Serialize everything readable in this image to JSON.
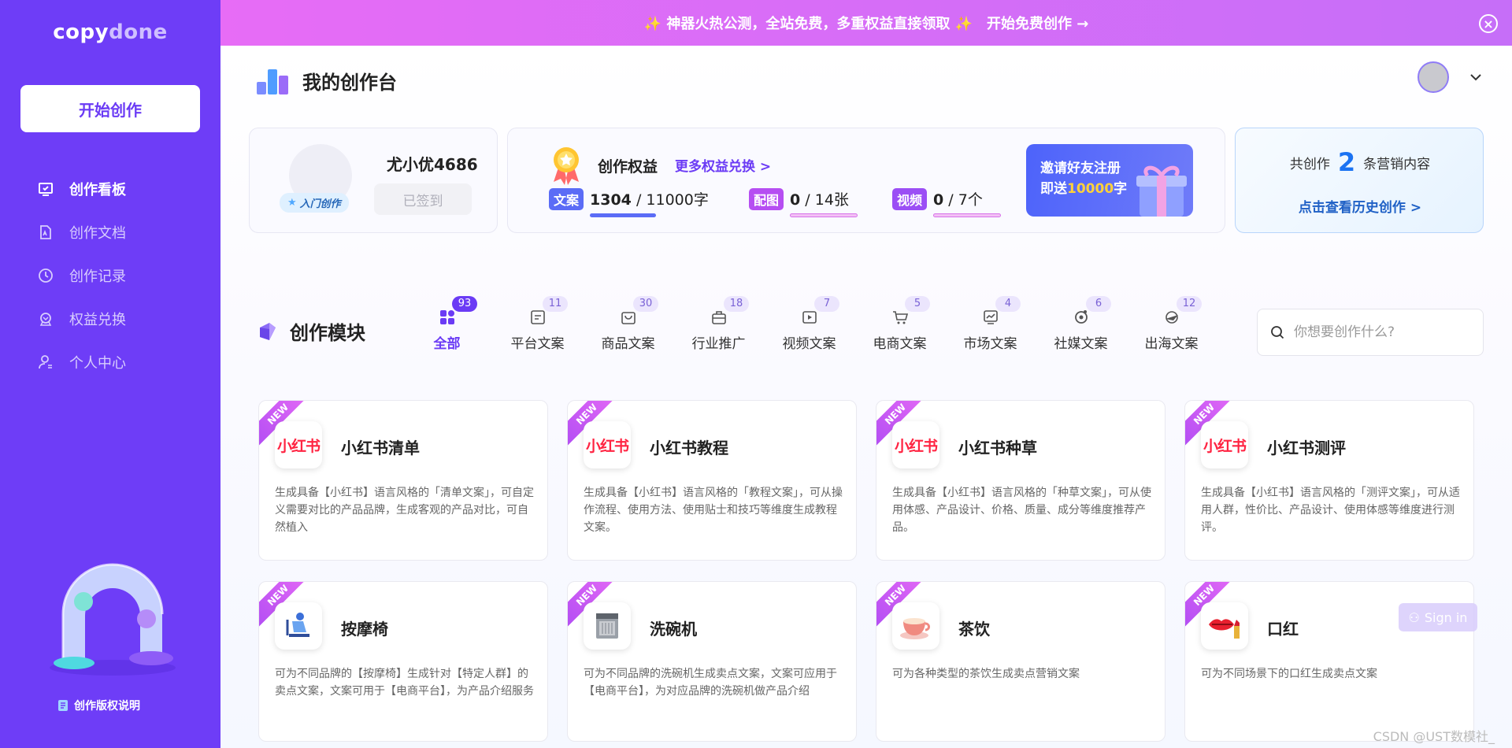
{
  "sidebar": {
    "logo_part1": "copy",
    "logo_part2": "done",
    "start_button": "开始创作",
    "nav": [
      {
        "label": "创作看板",
        "icon": "dashboard-icon",
        "active": true
      },
      {
        "label": "创作文档",
        "icon": "document-icon",
        "active": false
      },
      {
        "label": "创作记录",
        "icon": "clock-icon",
        "active": false
      },
      {
        "label": "权益兑换",
        "icon": "badge-icon",
        "active": false
      },
      {
        "label": "个人中心",
        "icon": "user-icon",
        "active": false
      }
    ],
    "copyright": "创作版权说明"
  },
  "banner": {
    "text": "✨ 神器火热公测，全站免费，多重权益直接领取 ✨",
    "cta": "开始免费创作 →"
  },
  "header": {
    "title": "我的创作台"
  },
  "user_card": {
    "username": "尤小优4686",
    "level": "入门创作",
    "signed": "已签到"
  },
  "quota_card": {
    "title": "创作权益",
    "more_link": "更多权益兑换 >",
    "items": [
      {
        "tag": "文案",
        "used": "1304",
        "total": " / 11000字",
        "color": "#5b6cf6"
      },
      {
        "tag": "配图",
        "used": "0",
        "total": " / 14张",
        "color": "#b64ef2"
      },
      {
        "tag": "视频",
        "used": "0",
        "total": " / 7个",
        "color": "#9b4ef5"
      }
    ],
    "invite_line1": "邀请好友注册",
    "invite_line2_prefix": "即送",
    "invite_line2_highlight": "10000",
    "invite_line2_suffix": "字"
  },
  "history_card": {
    "prefix": "共创作",
    "count": "2",
    "suffix": "条营销内容",
    "link": "点击查看历史创作 >"
  },
  "modules": {
    "title": "创作模块",
    "tabs": [
      {
        "label": "全部",
        "count": "93",
        "icon": "grid-icon",
        "active": true
      },
      {
        "label": "平台文案",
        "count": "11",
        "icon": "platform-icon",
        "active": false
      },
      {
        "label": "商品文案",
        "count": "30",
        "icon": "shopping-bag-icon",
        "active": false
      },
      {
        "label": "行业推广",
        "count": "18",
        "icon": "briefcase-icon",
        "active": false
      },
      {
        "label": "视频文案",
        "count": "7",
        "icon": "video-icon",
        "active": false
      },
      {
        "label": "电商文案",
        "count": "5",
        "icon": "cart-icon",
        "active": false
      },
      {
        "label": "市场文案",
        "count": "4",
        "icon": "chart-icon",
        "active": false
      },
      {
        "label": "社媒文案",
        "count": "6",
        "icon": "social-icon",
        "active": false
      },
      {
        "label": "出海文案",
        "count": "12",
        "icon": "plane-icon",
        "active": false
      }
    ],
    "search_placeholder": "你想要创作什么?"
  },
  "cards": [
    {
      "title": "小红书清单",
      "icon": "xiaohongshu-icon",
      "icon_text": "小红书",
      "badge": "NEW",
      "desc": "生成具备【小红书】语言风格的「清单文案」，可自定义需要对比的产品品牌，生成客观的产品对比，可自然植入"
    },
    {
      "title": "小红书教程",
      "icon": "xiaohongshu-icon",
      "icon_text": "小红书",
      "badge": "NEW",
      "desc": "生成具备【小红书】语言风格的「教程文案」，可从操作流程、使用方法、使用贴士和技巧等维度生成教程文案。"
    },
    {
      "title": "小红书种草",
      "icon": "xiaohongshu-icon",
      "icon_text": "小红书",
      "badge": "NEW",
      "desc": "生成具备【小红书】语言风格的「种草文案」，可从使用体感、产品设计、价格、质量、成分等维度推荐产品。"
    },
    {
      "title": "小红书测评",
      "icon": "xiaohongshu-icon",
      "icon_text": "小红书",
      "badge": "NEW",
      "desc": "生成具备【小红书】语言风格的「测评文案」，可从适用人群，性价比、产品设计、使用体感等维度进行测评。"
    },
    {
      "title": "按摩椅",
      "icon": "massage-chair-icon",
      "icon_text": "",
      "badge": "NEW",
      "desc": "可为不同品牌的【按摩椅】生成针对【特定人群】的卖点文案，文案可用于【电商平台】，为产品介绍服务"
    },
    {
      "title": "洗碗机",
      "icon": "dishwasher-icon",
      "icon_text": "",
      "badge": "NEW",
      "desc": "可为不同品牌的洗碗机生成卖点文案，文案可应用于【电商平台】，为对应品牌的洗碗机做产品介绍"
    },
    {
      "title": "茶饮",
      "icon": "tea-cup-icon",
      "icon_text": "",
      "badge": "NEW",
      "desc": "可为各种类型的茶饮生成卖点营销文案"
    },
    {
      "title": "口红",
      "icon": "lipstick-icon",
      "icon_text": "",
      "badge": "NEW",
      "desc": "可为不同场景下的口红生成卖点文案"
    }
  ],
  "floating": {
    "signin": "Sign in"
  },
  "watermark": "CSDN @UST数模社_"
}
